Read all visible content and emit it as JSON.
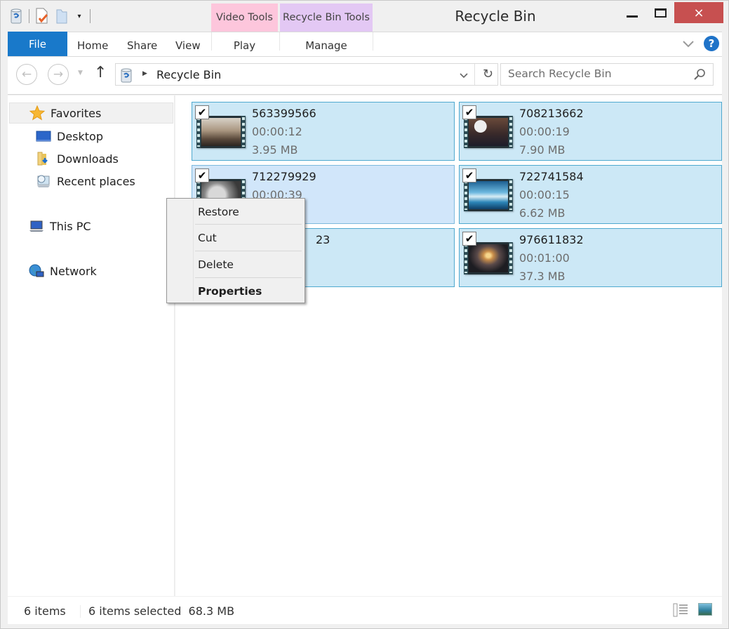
{
  "window": {
    "title": "Recycle Bin",
    "close_glyph": "×"
  },
  "quick_access": {
    "icons": [
      "recycle-bin-icon",
      "properties-icon",
      "new-folder-icon"
    ],
    "dropdown_glyph": "▾"
  },
  "contextual_tabs": {
    "video_tools": {
      "label": "Video Tools",
      "color": "#fdc6dc",
      "tab": "Play"
    },
    "recycle_bin_tools": {
      "label": "Recycle Bin Tools",
      "color": "#e3c8f4",
      "tab": "Manage"
    }
  },
  "ribbon": {
    "tabs": [
      "File",
      "Home",
      "Share",
      "View"
    ],
    "file_color": "#1979ca",
    "help_glyph": "?"
  },
  "navigation": {
    "back_glyph": "←",
    "forward_glyph": "→",
    "up_glyph": "↑",
    "refresh_glyph": "↻",
    "address_caret": "▶",
    "address_path": "Recycle Bin",
    "search_placeholder": "Search Recycle Bin"
  },
  "sidebar": {
    "favorites": "Favorites",
    "favorite_items": [
      "Desktop",
      "Downloads",
      "Recent places"
    ],
    "this_pc": "This PC",
    "network": "Network"
  },
  "files": [
    {
      "name": "563399566",
      "duration": "00:00:12",
      "size": "3.95 MB",
      "checked": true,
      "thumb": "classroom"
    },
    {
      "name": "708213662",
      "duration": "00:00:19",
      "size": "7.90 MB",
      "checked": true,
      "thumb": "people"
    },
    {
      "name": "712279929",
      "duration": "00:00:39",
      "size": "",
      "checked": true,
      "thumb": "clock"
    },
    {
      "name": "722741584",
      "duration": "00:00:15",
      "size": "6.62 MB",
      "checked": true,
      "thumb": "sky"
    },
    {
      "name": "…23",
      "duration": "",
      "size": "",
      "checked": true,
      "thumb": "hidden"
    },
    {
      "name": "976611832",
      "duration": "00:01:00",
      "size": "37.3 MB",
      "checked": true,
      "thumb": "sunset"
    }
  ],
  "checkmark_glyph": "✔",
  "context_menu": {
    "items": [
      "Restore",
      "Cut",
      "Delete",
      "Properties"
    ],
    "default_item": "Properties"
  },
  "statusbar": {
    "item_count": "6 items",
    "selection": "6 items selected  68.3 MB"
  },
  "colors": {
    "selection_bg": "#cce8f6",
    "selection_border": "#4fa9cf",
    "close_button": "#c75050",
    "help_icon": "#1f73c8"
  }
}
